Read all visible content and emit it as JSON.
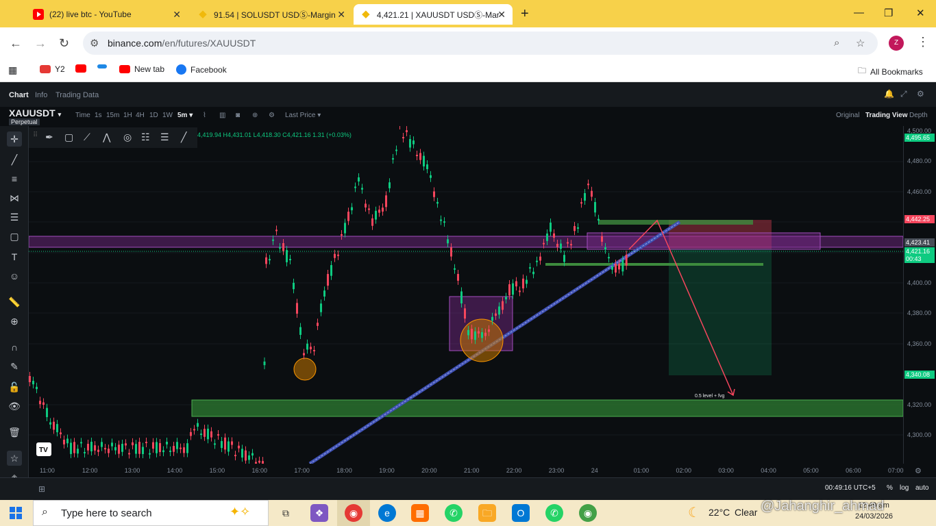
{
  "browser": {
    "tabs": [
      {
        "title": "(22) live btc - YouTube",
        "icon": "youtube-icon"
      },
      {
        "title": "91.54 | SOLUSDT USDⓈ-Margin",
        "icon": "binance-icon"
      },
      {
        "title": "4,421.21 | XAUUSDT USDⓈ-Mar",
        "icon": "binance-icon",
        "active": true
      }
    ],
    "url_host": "binance.com",
    "url_path": "/en/futures/XAUUSDT",
    "profile_initial": "Z",
    "bookmarks": [
      "Y2",
      "",
      "",
      "New tab",
      "Facebook"
    ],
    "all_bookmarks": "All Bookmarks"
  },
  "app": {
    "top_tabs": [
      "Chart",
      "Info",
      "Trading Data"
    ],
    "symbol": "XAUUSDT",
    "contract": "Perpetual",
    "timeframes": [
      "Time",
      "1s",
      "15m",
      "1H",
      "4H",
      "1D",
      "1W",
      "5m"
    ],
    "active_timeframe": "5m",
    "price_type": "Last Price",
    "views": [
      "Original",
      "Trading View",
      "Depth"
    ],
    "active_view": "Trading View",
    "ohlc": "4,419.94 H4,431.01 L4,418.30 C4,421.16 1.31 (+0.03%)",
    "annotation": "0.5 level + fvg",
    "price_ticks": [
      "4,500.00",
      "4,480.00",
      "4,460.00",
      "4,400.00",
      "4,380.00",
      "4,360.00",
      "4,320.00",
      "4,300.00"
    ],
    "price_badges": [
      {
        "label": "4,495.65",
        "color": "#0ecb81"
      },
      {
        "label": "4,442.25",
        "color": "#f6465d"
      },
      {
        "label": "4,423.41",
        "color": "#474d57"
      },
      {
        "label": "4,421.16",
        "color": "#0ecb81"
      },
      {
        "label": "00:43",
        "color": "#0ecb81"
      },
      {
        "label": "4,340.08",
        "color": "#0ecb81"
      }
    ],
    "time_ticks": [
      "11:00",
      "12:00",
      "13:00",
      "14:00",
      "15:00",
      "16:00",
      "17:00",
      "18:00",
      "19:00",
      "20:00",
      "21:00",
      "22:00",
      "23:00",
      "24",
      "01:00",
      "02:00",
      "03:00",
      "04:00",
      "05:00",
      "06:00",
      "07:00"
    ],
    "footer_clock": "00:49:16 UTC+5",
    "footer_opts": [
      "%",
      "log",
      "auto"
    ]
  },
  "taskbar": {
    "search_placeholder": "Type here to search",
    "weather_temp": "22°C",
    "weather_desc": "Clear",
    "time": "12:49 am",
    "date": "24/03/2026",
    "watermark": "@Jahanghir_ahmad"
  },
  "colors": {
    "up": "#0ecb81",
    "down": "#f6465d",
    "tab_bar": "#f7d14a"
  }
}
